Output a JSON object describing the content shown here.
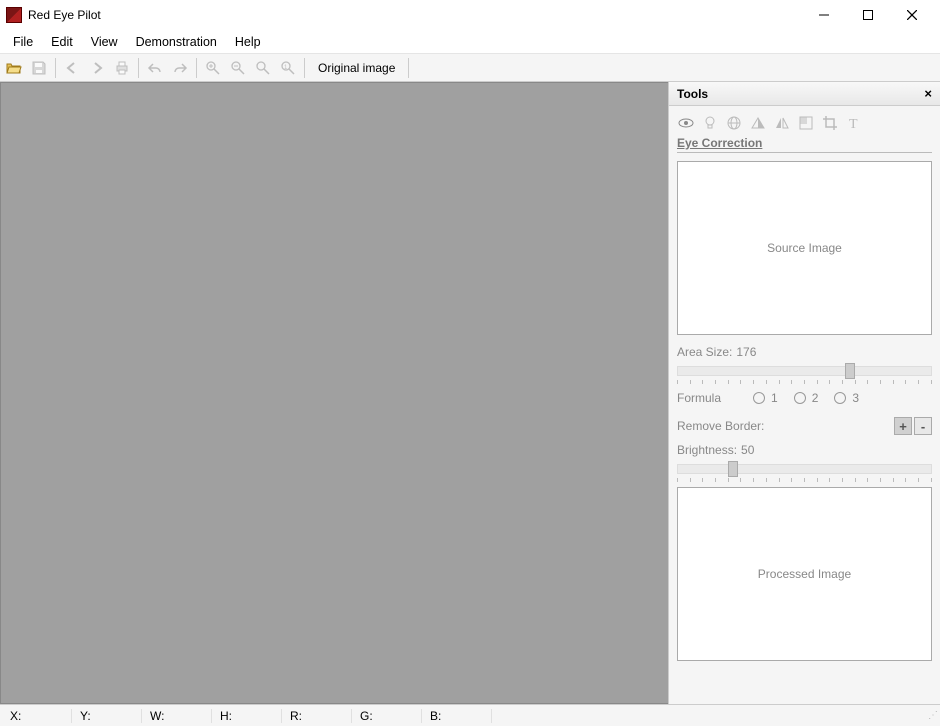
{
  "app": {
    "title": "Red Eye Pilot"
  },
  "menubar": {
    "items": [
      "File",
      "Edit",
      "View",
      "Demonstration",
      "Help"
    ]
  },
  "toolbar": {
    "original_label": "Original image"
  },
  "tools_panel": {
    "title": "Tools",
    "section_title": "Eye Correction",
    "source_image_label": "Source Image",
    "processed_image_label": "Processed Image",
    "area_size_label": "Area Size:",
    "area_size_value": "176",
    "formula_label": "Formula",
    "formula_options": [
      "1",
      "2",
      "3"
    ],
    "remove_border_label": "Remove Border:",
    "brightness_label": "Brightness:",
    "brightness_value": "50"
  },
  "statusbar": {
    "x_label": "X:",
    "y_label": "Y:",
    "w_label": "W:",
    "h_label": "H:",
    "r_label": "R:",
    "g_label": "G:",
    "b_label": "B:"
  }
}
